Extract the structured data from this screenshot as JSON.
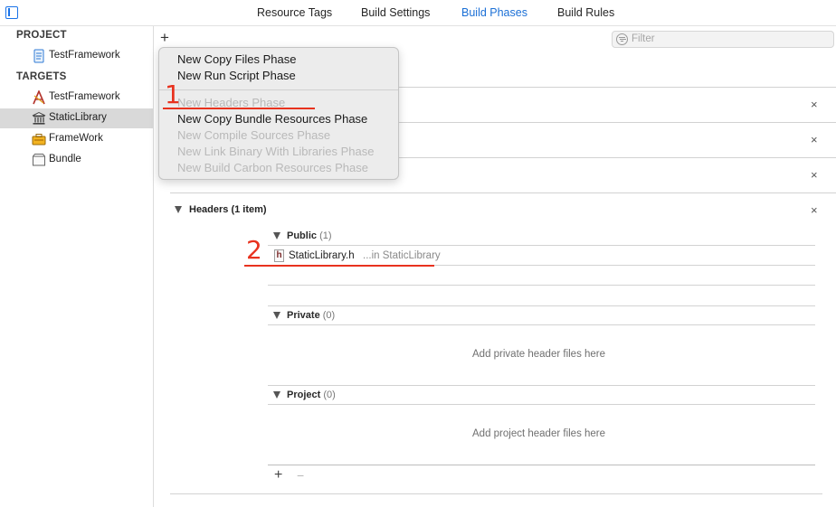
{
  "tabs": [
    {
      "label": "Resource Tags",
      "active": false
    },
    {
      "label": "Build Settings",
      "active": false
    },
    {
      "label": "Build Phases",
      "active": true
    },
    {
      "label": "Build Rules",
      "active": false
    }
  ],
  "sidebar": {
    "project_heading": "PROJECT",
    "project_item": "TestFramework",
    "targets_heading": "TARGETS",
    "targets": [
      {
        "label": "TestFramework",
        "icon": "app-icon",
        "selected": false
      },
      {
        "label": "StaticLibrary",
        "icon": "library-icon",
        "selected": true
      },
      {
        "label": "FrameWork",
        "icon": "toolbox-icon",
        "selected": false
      },
      {
        "label": "Bundle",
        "icon": "bundle-icon",
        "selected": false
      }
    ]
  },
  "toolbar": {
    "add_symbol": "+",
    "filter_placeholder": "Filter"
  },
  "menu": {
    "items": [
      {
        "label": "New Copy Files Phase",
        "enabled": true
      },
      {
        "label": "New Run Script Phase",
        "enabled": true
      },
      {
        "label": "New Headers Phase",
        "enabled": false
      },
      {
        "label": "New Copy Bundle Resources Phase",
        "enabled": true
      },
      {
        "label": "New Compile Sources Phase",
        "enabled": false
      },
      {
        "label": "New Link Binary With Libraries Phase",
        "enabled": false
      },
      {
        "label": "New Build Carbon Resources Phase",
        "enabled": false
      }
    ]
  },
  "headers_phase": {
    "title": "Headers (1 item)",
    "public": {
      "label": "Public",
      "count": "(1)"
    },
    "file": {
      "name": "StaticLibrary.h",
      "location": "...in StaticLibrary",
      "icon_letter": "h"
    },
    "private": {
      "label": "Private",
      "count": "(0)",
      "hint": "Add private header files here"
    },
    "project": {
      "label": "Project",
      "count": "(0)",
      "hint": "Add project header files here"
    }
  },
  "controls": {
    "close_symbol": "×",
    "plus_symbol": "+",
    "minus_symbol": "−"
  },
  "annotations": {
    "one": "1",
    "two": "2",
    "color": "#e8321e"
  },
  "colors": {
    "accent": "#1a6fd6",
    "selection": "#d9d9d9",
    "annotation": "#e8321e"
  }
}
